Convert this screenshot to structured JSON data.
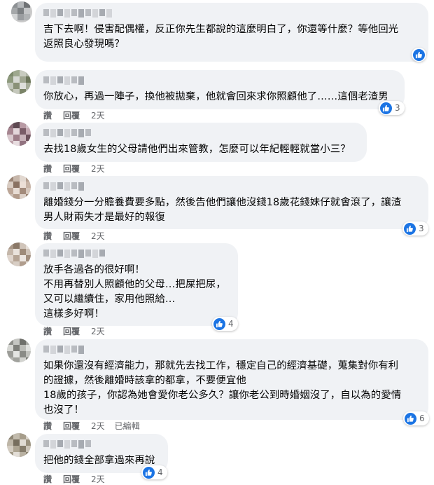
{
  "actions": {
    "like": "讚",
    "reply": "回覆"
  },
  "comments": [
    {
      "text": "吉下去啊！侵害配偶權，反正你先生都說的這麼明白了，你還等什麼？等他回光\n返照良心發現嗎？",
      "time": "",
      "reactions": ""
    },
    {
      "text": "你放心，再過一陣子，換他被拋棄，他就會回來求你照顧他了……這個老渣男",
      "time": "2天",
      "reactions": "3"
    },
    {
      "text": "去找18歲女生的父母請他們出來管教，怎麼可以年紀輕輕就當小三？",
      "time": "2天",
      "reactions": ""
    },
    {
      "text": "離婚錢分一分贍養費要多點，然後告他們讓他沒錢18歲花錢妹仔就會滾了，讓渣\n男人財兩失才是最好的報復",
      "time": "2天",
      "reactions": "3"
    },
    {
      "text": "放手各過各的很好啊！\n不用再替別人照顧他的父母…把屎把尿，\n又可以繼續住，家用他照給…\n這樣多好啊！",
      "time": "2天",
      "reactions": "4"
    },
    {
      "text": "如果你還沒有經濟能力，那就先去找工作，穩定自己的經濟基礎，蒐集對你有利\n的證據，然後離婚時該拿的都拿，不要便宜他\n18歲的孩子，你認為她會愛你老公多久？讓你老公到時婚姻沒了，自以為的愛情\n也沒了！",
      "time": "2天",
      "edited": "已編輯",
      "reactions": "6"
    },
    {
      "text": "把他的錢全部拿過來再說",
      "time": "2天",
      "reactions": "4"
    }
  ],
  "colors": {
    "bubble": "#f0f2f5",
    "meta_text": "#65676b",
    "like_blue": "#1b74e4"
  },
  "icons": {
    "like": "thumbs-up-icon"
  }
}
